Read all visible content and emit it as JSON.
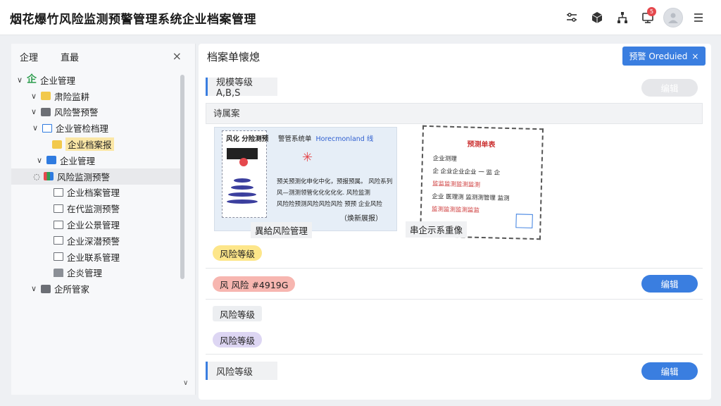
{
  "app": {
    "title": "烟花爆竹风险监测预警管理系统企业档案管理"
  },
  "topbar": {
    "icons": [
      "sliders-icon",
      "cube-icon",
      "network-icon",
      "monitor-icon",
      "avatar",
      "menu-icon"
    ],
    "notification_count": "5"
  },
  "left_panel": {
    "tabs": [
      "企理",
      "直最"
    ],
    "close_label": "×",
    "tree": [
      {
        "label": "企业管理",
        "level": 0,
        "expanded": true,
        "icon": "enterprise-icon"
      },
      {
        "label": "肃险监耕",
        "level": 1,
        "expanded": true,
        "icon": "folder-icon"
      },
      {
        "label": "风险警预警",
        "level": 1,
        "expanded": true,
        "icon": "folder-icon"
      },
      {
        "label": "企业管检档理",
        "level": 1,
        "expanded": true,
        "icon": "table-icon"
      },
      {
        "label": "企业档案报",
        "level": 2,
        "expanded": false,
        "icon": "folder-icon",
        "highlight": true
      },
      {
        "label": "企业管理",
        "level": 1,
        "expanded": true,
        "icon": "box-icon"
      },
      {
        "label": "风险监测预警",
        "level": 0,
        "expanded": false,
        "icon": "monitor-icon",
        "selected": true
      },
      {
        "label": "企业档案管理",
        "level": 2,
        "icon": "doc-icon"
      },
      {
        "label": "在代监测预警",
        "level": 2,
        "icon": "doc-icon"
      },
      {
        "label": "企业公景管理",
        "level": 2,
        "icon": "doc-icon"
      },
      {
        "label": "企业深潜预警",
        "level": 2,
        "icon": "doc-icon"
      },
      {
        "label": "企业联系管理",
        "level": 2,
        "icon": "doc-icon"
      },
      {
        "label": "企炎管理",
        "level": 2,
        "icon": "bank-icon"
      },
      {
        "label": "企所管家",
        "level": 1,
        "expanded": true,
        "icon": "folder-icon"
      }
    ]
  },
  "main": {
    "title": "档案单懐熄",
    "primary_button": "预警 Oreduied",
    "section1": {
      "label": "规模等级 A,B,S",
      "edit": "编辑"
    },
    "docs_label": "诗属案",
    "doc1": {
      "header": "风化 分险测预",
      "subheader": "警管系统单",
      "english": "Horecmonland 线",
      "lines": [
        "预关预测化申化中化，预报预属。  风险系列",
        "风—测测领管化化化化化.  风险监测",
        "风险险预测风险风险风险  预预  企业风险"
      ],
      "note": "（焕新展报）",
      "caption": "異給风险管理"
    },
    "doc2": {
      "title": "预测单表",
      "lines": [
        "企业测理",
        "企  企业企业企业 一 监 企",
        "监监监测监测监测",
        "企业  医理测  监测测管理 监测",
        "监测监测监测监监"
      ],
      "caption": "串企示系重像"
    },
    "tags": {
      "t1": "风险等级",
      "t2": "风 风险 #4919G",
      "t3": "风险等级",
      "t4": "风险等级",
      "t5": "风险等级"
    },
    "edit_labels": [
      "编辑",
      "编辑"
    ]
  }
}
